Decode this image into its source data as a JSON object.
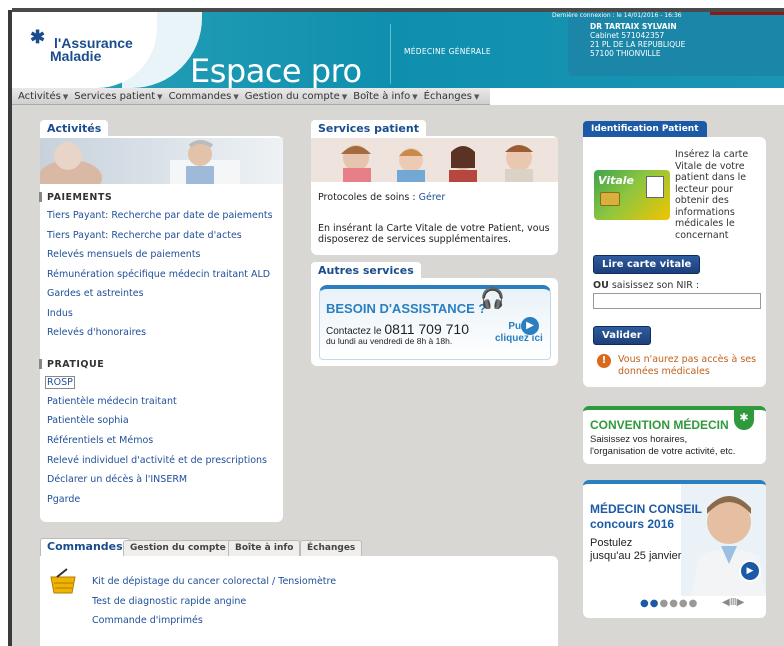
{
  "header": {
    "logo_line1": "l'Assurance",
    "logo_line2": "Maladie",
    "title": "Espace pro",
    "specialty": "MÉDECINE GÉNÉRALE",
    "doctor_name": "DR TARTAIX SYLVAIN",
    "doctor_cabinet": "Cabinet 571042357",
    "doctor_address1": "21 PL DE LA REPUBLIQUE",
    "doctor_address2": "57100 THIONVILLE",
    "last_connection": "Dernière connexion : le 14/01/2016 - 16:36"
  },
  "nav": {
    "items": [
      "Activités",
      "Services patient",
      "Commandes",
      "Gestion du compte",
      "Boîte à info",
      "Échanges"
    ]
  },
  "activites": {
    "tab": "Activités",
    "paiements_title": "PAIEMENTS",
    "paiements": [
      "Tiers Payant: Recherche par date de paiements",
      "Tiers Payant: Recherche par date d'actes",
      "Relevés mensuels de paiements",
      "Rémunération spécifique médecin traitant ALD",
      "Gardes et astreintes",
      "Indus",
      "Relevés d'honoraires"
    ],
    "pratique_title": "PRATIQUE",
    "pratique": [
      "ROSP",
      "Patientèle médecin traitant",
      "Patientèle sophia",
      "Référentiels et Mémos",
      "Relevé individuel d'activité et de prescriptions",
      "Déclarer un décès à l'INSERM",
      "Pgarde"
    ]
  },
  "services": {
    "tab": "Services patient",
    "protocoles_label": "Protocoles de soins :",
    "protocoles_link": "Gérer",
    "vitale_text1": "En insérant la Carte Vitale de votre Patient, vous",
    "vitale_text2": "disposerez de services supplémentaires."
  },
  "autres": {
    "tab": "Autres services",
    "title": "BESOIN D'ASSISTANCE ?",
    "contact_prefix": "Contactez le",
    "phone": "0811 709 710",
    "hours": "du lundi au vendredi de 8h à 18h.",
    "puis": "Puis",
    "cliquez": "cliquez ici"
  },
  "identification": {
    "tab": "Identification Patient",
    "card_label": "Vitale",
    "instr": [
      "Insérez la carte",
      "Vitale de votre",
      "patient dans le",
      "lecteur pour",
      "obtenir des",
      "informations",
      "médicales le",
      "concernant"
    ],
    "read_button": "Lire carte vitale",
    "ou_label": "OU",
    "nir_label": "saisissez son NIR :",
    "nir_value": "",
    "valider_button": "Valider",
    "warning1": "Vous n'aurez pas accès à ses",
    "warning2": "données médicales"
  },
  "convention": {
    "title": "CONVENTION MÉDECIN",
    "line1": "Saisissez vos horaires,",
    "line2": "l'organisation de votre activité, etc."
  },
  "conseil": {
    "title1": "MÉDECIN CONSEIL",
    "title2": "concours 2016",
    "line1": "Postulez",
    "line2": "jusqu'au 25 janvier"
  },
  "bottom": {
    "tabs": [
      "Commandes",
      "Gestion du compte",
      "Boîte à info",
      "Échanges"
    ],
    "links": [
      "Kit de dépistage du cancer colorectal / Tensiomètre",
      "Test de diagnostic rapide angine",
      "Commande d'imprimés"
    ]
  },
  "colors": {
    "header": "#0f8fae",
    "link": "#1f4f9a",
    "brand_blue": "#1b4d8c",
    "convention_green": "#2e9a3c",
    "background": "#d8d7d3"
  }
}
